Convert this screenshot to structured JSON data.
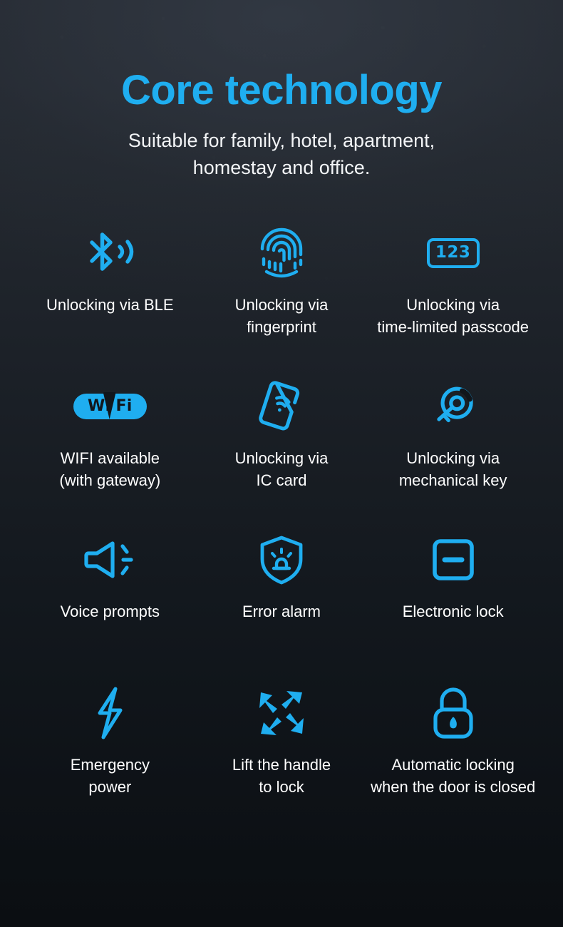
{
  "theme": {
    "accent": "#1FAEF0",
    "text": "#ffffff",
    "bg_top": "#272c34",
    "bg_bottom": "#0b0e12"
  },
  "header": {
    "title": "Core technology",
    "subtitle_line1": "Suitable for family, hotel, apartment,",
    "subtitle_line2": "homestay and office."
  },
  "features": [
    [
      {
        "icon": "bluetooth-icon",
        "label": "Unlocking via BLE"
      },
      {
        "icon": "fingerprint-icon",
        "label": "Unlocking via\nfingerprint"
      },
      {
        "icon": "passcode-123-icon",
        "label": "Unlocking via\ntime-limited passcode",
        "badge_text": "123"
      }
    ],
    [
      {
        "icon": "wifi-logo-icon",
        "label": "WIFI available\n(with gateway)",
        "logo_text_1": "Wi",
        "logo_text_2": "Fi"
      },
      {
        "icon": "ic-card-nfc-icon",
        "label": "Unlocking via\nIC card"
      },
      {
        "icon": "key-icon",
        "label": "Unlocking via\nmechanical key"
      }
    ],
    [
      {
        "icon": "speaker-icon",
        "label": "Voice prompts"
      },
      {
        "icon": "shield-alarm-icon",
        "label": "Error alarm"
      },
      {
        "icon": "electronic-lock-icon",
        "label": "Electronic lock"
      }
    ],
    [
      {
        "icon": "lightning-bolt-icon",
        "label": "Emergency\npower"
      },
      {
        "icon": "arrows-inward-icon",
        "label": "Lift the handle\nto lock"
      },
      {
        "icon": "padlock-closed-icon",
        "label": "Automatic locking\nwhen the door is closed"
      }
    ]
  ]
}
